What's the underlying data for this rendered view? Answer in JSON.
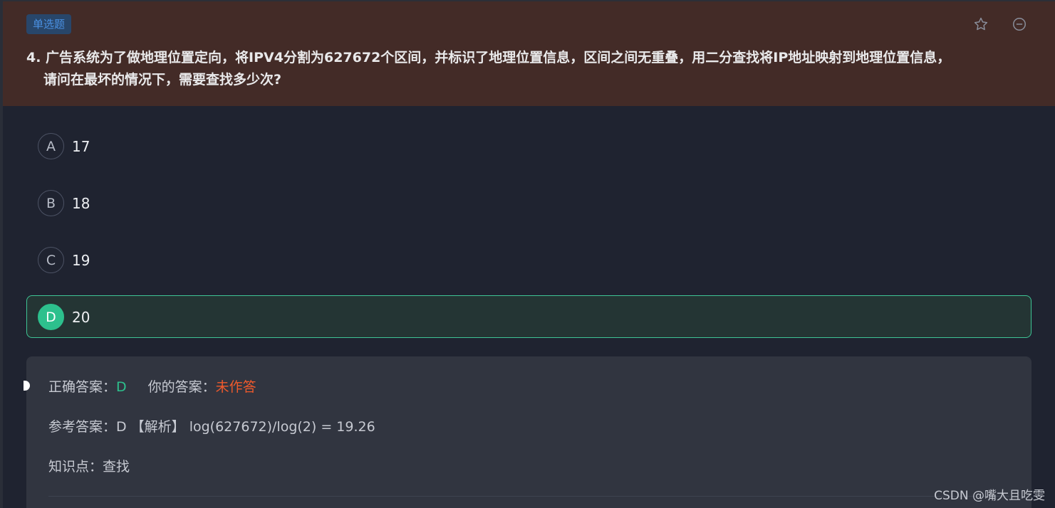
{
  "question": {
    "type_tag": "单选题",
    "line1": "4. 广告系统为了做地理位置定向，将IPV4分割为627672个区间，并标识了地理位置信息，区间之间无重叠，用二分查找将IP地址映射到地理位置信息，",
    "line2": "请问在最坏的情况下，需要查找多少次?"
  },
  "options": [
    {
      "letter": "A",
      "value": "17"
    },
    {
      "letter": "B",
      "value": "18"
    },
    {
      "letter": "C",
      "value": "19"
    },
    {
      "letter": "D",
      "value": "20"
    }
  ],
  "analysis": {
    "correct_label": "正确答案：",
    "correct_value": "D",
    "your_label": "你的答案：",
    "your_value": "未作答",
    "reference": "参考答案：D 【解析】 log(627672)/log(2) = 19.26",
    "knowledge": "知识点：查找"
  },
  "watermark": "CSDN @嘴大且吃雯",
  "icons": [
    "star-icon",
    "minus-circle-icon"
  ],
  "colors": {
    "correct": "#2dc08d",
    "unanswered": "#f05a2c",
    "tag": "#4a90e2"
  }
}
